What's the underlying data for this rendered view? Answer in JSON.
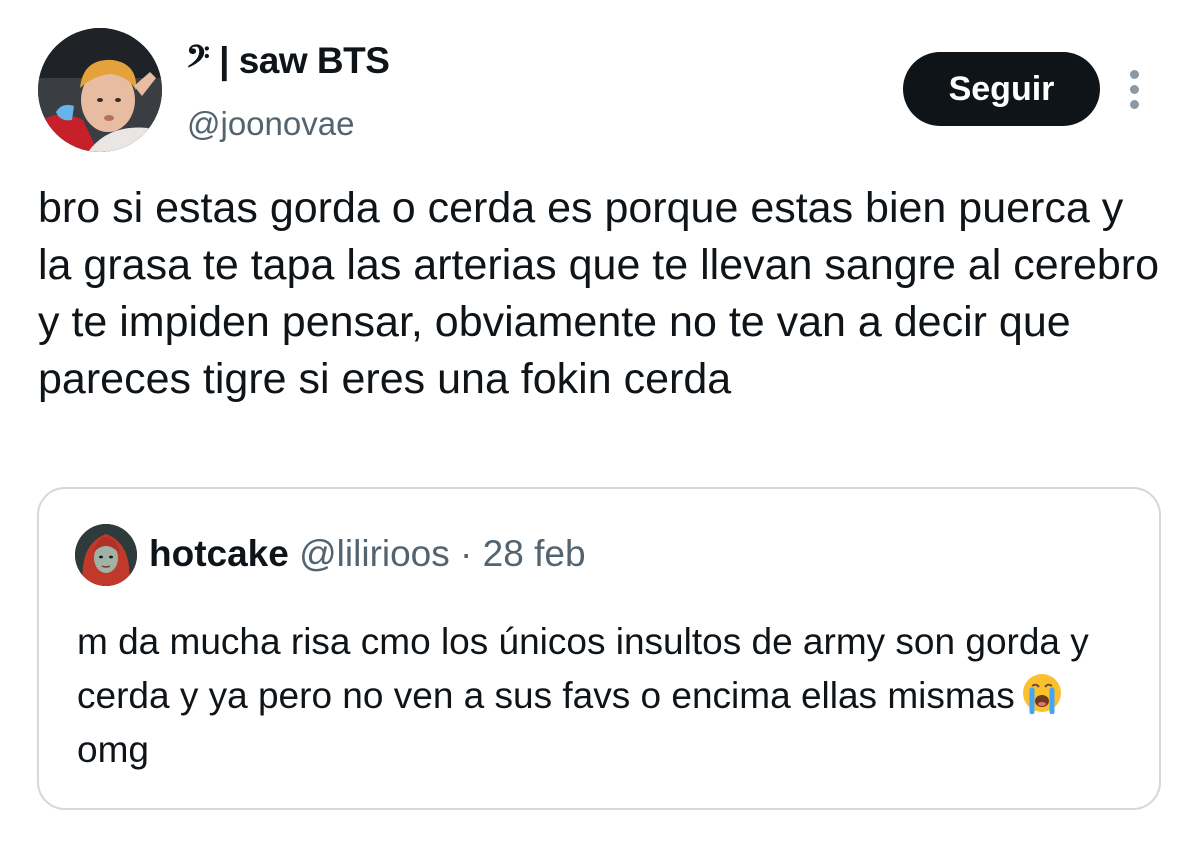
{
  "author": {
    "name_icon": "bass-clef-icon",
    "name_symbol": "𝄢",
    "name": "| saw BTS",
    "handle": "@joonovae",
    "avatar_icon": "user-avatar-photo"
  },
  "actions": {
    "follow_label": "Seguir",
    "more_icon": "more-vertical-icon"
  },
  "tweet": {
    "text": "bro si estas gorda o cerda es porque estas bien puerca y la grasa te tapa las arterias que te llevan sangre al cerebro y te impiden pensar, obviamente no te van a decir que pareces tigre si eres una fokin cerda"
  },
  "quoted_tweet": {
    "avatar_icon": "quoted-user-avatar",
    "name": "hotcake",
    "handle": "@lilirioos",
    "separator": "·",
    "date": "28 feb",
    "text_before_emoji": "m da mucha risa cmo los únicos insultos de army son gorda y cerda y ya pero no ven a sus favs o encima ellas mismas",
    "emoji": "loudly-crying-face-icon",
    "text_after_emoji": "omg"
  },
  "colors": {
    "text": "#0f1419",
    "secondary_text": "#536471",
    "button_bg": "#0f1419",
    "button_text": "#ffffff",
    "border": "#cfd9de"
  }
}
